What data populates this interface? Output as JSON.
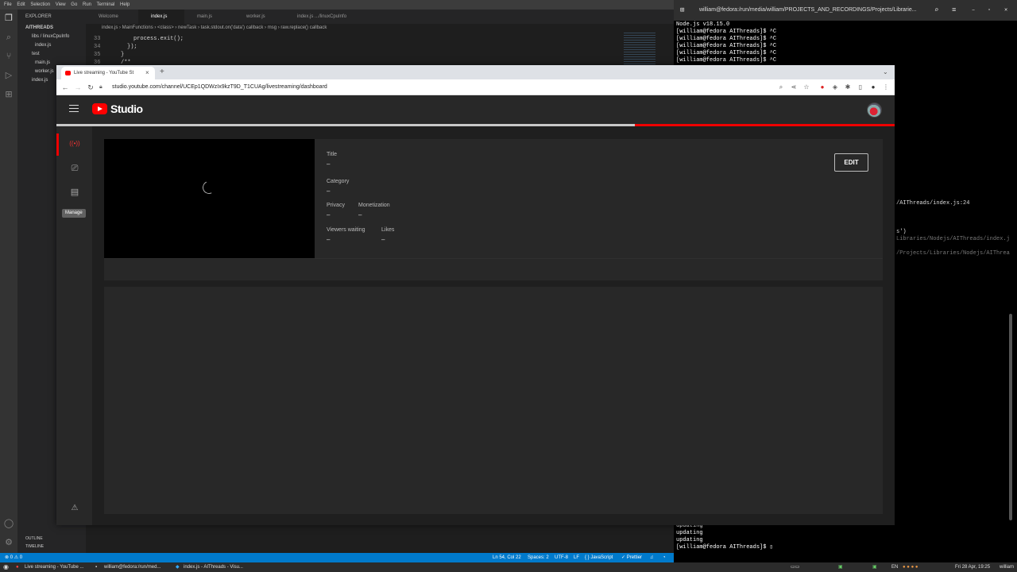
{
  "vscode": {
    "menu": [
      "File",
      "Edit",
      "Selection",
      "View",
      "Go",
      "Run",
      "Terminal",
      "Help"
    ],
    "explorer_header": "EXPLORER",
    "project": "AITHREADS",
    "tree": [
      "libs / linuxCpuInfo",
      "index.js",
      "test",
      "main.js",
      "worker.js",
      "index.js"
    ],
    "tabs": [
      "Welcome",
      "index.js",
      "main.js",
      "worker.js",
      "index.js  .../linuxCpuInfo"
    ],
    "breadcrumb": "index.js  ›  MainFunctions  ›  <class>  ›  newTask  ›  task.stdout.on('data') callback  ›  msg  ›  raw.replace() callback",
    "code_lines": [
      {
        "n": "33",
        "t": "process.exit();"
      },
      {
        "n": "34",
        "t": "});"
      },
      {
        "n": "35",
        "t": "}"
      },
      {
        "n": "36",
        "t": "/**"
      }
    ],
    "outline": "OUTLINE",
    "timeline": "TIMELINE",
    "status": {
      "errors": "⊗ 0 ⚠ 0",
      "position": "Ln 54, Col 22",
      "spaces": "Spaces: 2",
      "encoding": "UTF-8",
      "eol": "LF",
      "language": "{ } JavaScript",
      "prettier": "✓ Prettier"
    }
  },
  "terminal": {
    "title": "william@fedora:/run/media/william/PROJECTS_AND_RECORDINGS/Projects/Librarie...",
    "top_lines": "Node.js v18.15.0\n[william@fedora AIThreads]$ ^C\n[william@fedora AIThreads]$ ^C\n[william@fedora AIThreads]$ ^C\n[william@fedora AIThreads]$ ^C\n[william@fedora AIThreads]$ ^C",
    "frag1": "/AIThreads/index.js:24",
    "frag2": "s')",
    "frag3": "Libraries/Nodejs/AIThreads/index.j",
    "frag4": "/Projects/Libraries/Nodejs/AIThrea",
    "bottom_lines": "updating\nupdating\nupdating\n[william@fedora AIThreads]$ ▯"
  },
  "taskbar": {
    "item1": "Live streaming - YouTube ...",
    "item2": "william@fedora:/run/med...",
    "item3": "index.js - AIThreads - Visu...",
    "lang": "EN",
    "clock": "Fri 28 Apr, 19:25",
    "user": "william"
  },
  "chrome": {
    "tab_title": "Live streaming - YouTube St",
    "url": "studio.youtube.com/channel/UCEp1QDWzIx9kzT9D_T1CUAg/livestreaming/dashboard"
  },
  "studio": {
    "logo_text": "Studio",
    "tooltip": "Manage",
    "fields": {
      "title_label": "Title",
      "title_value": "–",
      "category_label": "Category",
      "category_value": "–",
      "privacy_label": "Privacy",
      "privacy_value": "–",
      "monetization_label": "Monetization",
      "monetization_value": "–",
      "viewers_label": "Viewers waiting",
      "viewers_value": "–",
      "likes_label": "Likes",
      "likes_value": "–"
    },
    "edit_label": "EDIT",
    "load_progress": 0.31
  },
  "colors": {
    "yt_red": "#ff0000",
    "vscode_status": "#007acc"
  }
}
